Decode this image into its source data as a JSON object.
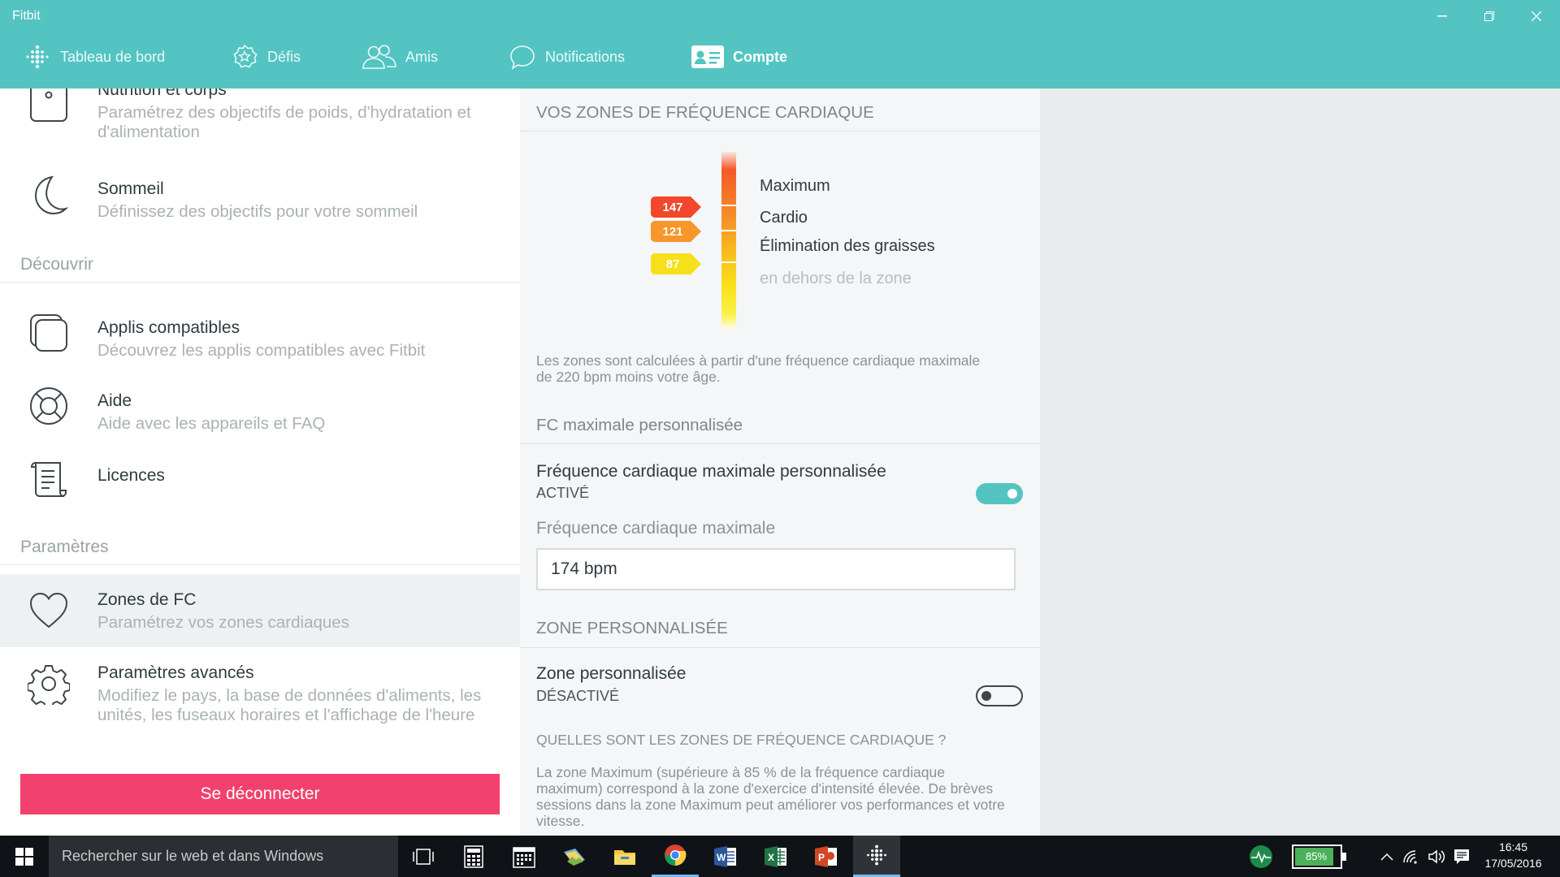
{
  "app": {
    "title": "Fitbit"
  },
  "nav": {
    "items": [
      {
        "label": "Tableau de bord",
        "icon": "dots-icon"
      },
      {
        "label": "Défis",
        "icon": "star-badge-icon"
      },
      {
        "label": "Amis",
        "icon": "friends-icon"
      },
      {
        "label": "Notifications",
        "icon": "chat-bubble-icon"
      },
      {
        "label": "Compte",
        "icon": "account-card-icon"
      }
    ],
    "active": "Compte"
  },
  "left": {
    "items": [
      {
        "title": "Nutrition et corps",
        "desc": "Paramétrez des objectifs de poids, d'hydratation et d'alimentation"
      },
      {
        "title": "Sommeil",
        "desc": "Définissez des objectifs pour votre sommeil"
      },
      {
        "title": "Applis compatibles",
        "desc": "Découvrez les applis compatibles avec Fitbit"
      },
      {
        "title": "Aide",
        "desc": "Aide avec les appareils et FAQ"
      },
      {
        "title": "Licences",
        "desc": ""
      },
      {
        "title": "Zones de FC",
        "desc": "Paramétrez vos zones cardiaques"
      },
      {
        "title": "Paramètres avancés",
        "desc": "Modifiez le pays, la base de données d'aliments, les unités, les fuseaux horaires et l'affichage de l'heure"
      }
    ],
    "sections": {
      "discover": "Découvrir",
      "settings": "Paramètres"
    },
    "logout_label": "Se déconnecter"
  },
  "zones": {
    "heading": "VOS ZONES DE FRÉQUENCE CARDIAQUE",
    "labels": [
      "Maximum",
      "Cardio",
      "Élimination des graisses",
      "en dehors de la zone"
    ],
    "thresholds": [
      147,
      121,
      87
    ],
    "threshold_colors": [
      "#f2472c",
      "#f7962a",
      "#f6e01a"
    ],
    "note": "Les zones sont calculées à partir d'une fréquence cardiaque maximale de 220 bpm moins votre âge."
  },
  "custom_max": {
    "heading": "FC maximale personnalisée",
    "title": "Fréquence cardiaque maximale personnalisée",
    "state": "ACTIVÉ",
    "enabled": true,
    "field_label": "Fréquence cardiaque maximale",
    "field_value": "174 bpm"
  },
  "custom_zone": {
    "heading": "ZONE PERSONNALISÉE",
    "title": "Zone personnalisée",
    "state": "DÉSACTIVÉ",
    "enabled": false
  },
  "faq": {
    "question": "QUELLES SONT LES ZONES DE FRÉQUENCE CARDIAQUE ?",
    "answer": "La zone Maximum (supérieure à 85 % de la fréquence cardiaque maximum) correspond à la zone d'exercice d'intensité élevée. De brèves sessions dans la zone Maximum peut améliorer vos performances et votre vitesse."
  },
  "taskbar": {
    "search_placeholder": "Rechercher sur le web et dans Windows",
    "battery": "85%",
    "time": "16:45",
    "date": "17/05/2016"
  },
  "colors": {
    "header": "#53c4c2",
    "accent": "#53c4c2",
    "logout": "#f2416f"
  }
}
